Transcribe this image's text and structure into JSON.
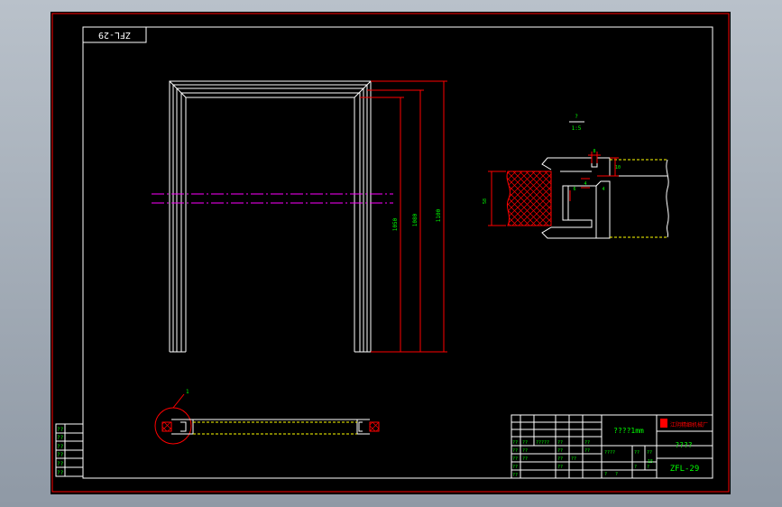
{
  "drawing": {
    "code_stamp": "ZFL-29",
    "scale_label": "????1mm",
    "logo_text": "江阴精细机械厂",
    "title_right": "????",
    "drawing_number": "ZFL-29",
    "detail_marker": "1"
  },
  "revision_table": {
    "rows": [
      "??",
      "??",
      "??",
      "??",
      "??",
      "??"
    ]
  },
  "title_block": {
    "row_a": [
      "??",
      "??",
      "?????",
      "??",
      "??"
    ],
    "row_b": [
      "??",
      "??",
      "??",
      "??"
    ],
    "row_c": [
      "??",
      "??",
      "??",
      "??"
    ],
    "row_d": [
      "??",
      "??",
      "??"
    ],
    "weight_label": "????",
    "mass_a": "??",
    "mass_b": "??",
    "sheet_a": "?",
    "sheet_b": "?",
    "count_a": "?",
    "count_b": "?",
    "sheet_scale": "15"
  },
  "dimensions": {
    "height_inner": "1050",
    "height_mid": "1080",
    "height_outer": "1100",
    "section_height": "58",
    "section_note_top": "?",
    "section_note_bot": "1:5",
    "d1": "8",
    "d2": "10",
    "d3": "4",
    "d4": "6",
    "d5": "4"
  },
  "colors": {
    "frame": "#ff0000",
    "line": "#ffffff",
    "centerline": "#ff00ff",
    "text": "#00ff00",
    "hatch": "#ff0000",
    "fill_line": "#ffff00"
  }
}
